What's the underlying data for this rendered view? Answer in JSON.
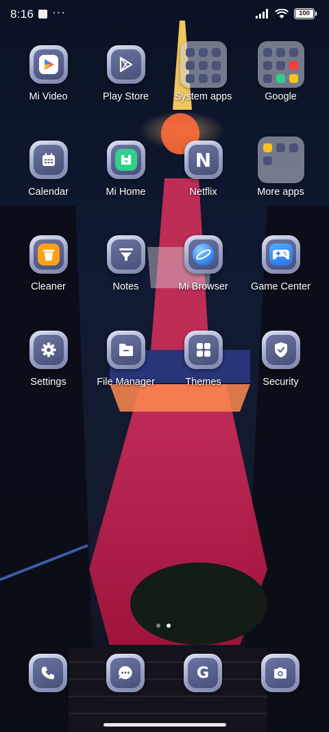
{
  "status_bar": {
    "time": "8:16",
    "notification_icons": [
      "notification-square-icon",
      "more-dots-icon"
    ],
    "more_indicator": "···",
    "battery": "100",
    "right_icons": [
      "signal-icon",
      "wifi-icon",
      "battery-icon"
    ]
  },
  "apps": [
    {
      "label": "Mi Video",
      "icon": "mi-video-icon"
    },
    {
      "label": "Play Store",
      "icon": "play-store-icon"
    },
    {
      "label": "System apps",
      "icon": "folder-icon"
    },
    {
      "label": "Google",
      "icon": "folder-icon"
    },
    {
      "label": "Calendar",
      "icon": "calendar-icon"
    },
    {
      "label": "Mi Home",
      "icon": "mi-home-icon"
    },
    {
      "label": "Netflix",
      "icon": "netflix-icon",
      "glyph": "N"
    },
    {
      "label": "More apps",
      "icon": "folder-icon"
    },
    {
      "label": "Cleaner",
      "icon": "cleaner-icon"
    },
    {
      "label": "Notes",
      "icon": "notes-icon"
    },
    {
      "label": "Mi Browser",
      "icon": "mi-browser-icon"
    },
    {
      "label": "Game Center",
      "icon": "game-center-icon"
    },
    {
      "label": "Settings",
      "icon": "gear-icon"
    },
    {
      "label": "File Manager",
      "icon": "file-manager-icon"
    },
    {
      "label": "Themes",
      "icon": "themes-icon"
    },
    {
      "label": "Security",
      "icon": "shield-icon"
    }
  ],
  "page_indicator": {
    "pages": 2,
    "active": 2
  },
  "dock": [
    {
      "icon": "phone-icon"
    },
    {
      "icon": "messages-icon"
    },
    {
      "icon": "google-icon",
      "glyph": "G"
    },
    {
      "icon": "camera-icon"
    }
  ],
  "colors": {
    "accent_green": "#2fcf8c",
    "accent_orange": "#f7a21b",
    "accent_blue": "#3a8cf5",
    "icon_base": "#5a628c"
  }
}
